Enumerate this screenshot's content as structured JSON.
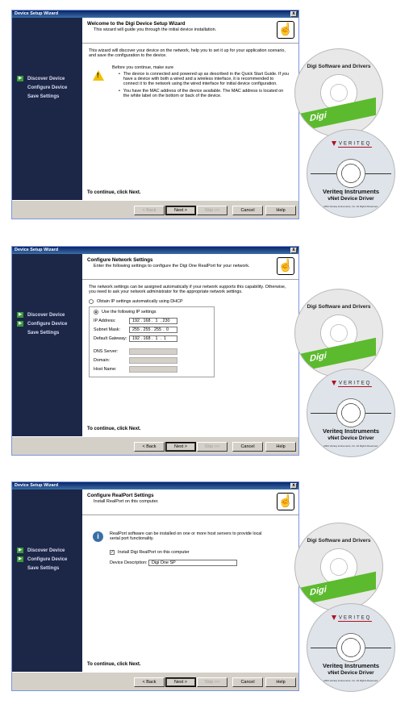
{
  "window_title": "Device Setup Wizard",
  "close_glyph": "x",
  "steps": [
    "Discover Device",
    "Configure Device",
    "Save Settings"
  ],
  "buttons": {
    "back": "< Back",
    "next": "Next >",
    "skip": "Skip >>",
    "cancel": "Cancel",
    "help": "Help"
  },
  "footer": "To continue, click Next.",
  "wizard_icon": "hand-pointer-icon",
  "screen1": {
    "title": "Welcome to the Digi Device Setup Wizard",
    "subtitle": "This wizard will guide you through the initial device installation.",
    "intro": "This wizard will discover your device on the network, help you to set it up for your application scenario, and save the configuration to the device.",
    "before": "Before you continue, make sure",
    "bullet1": "The device is connected and powered up as described in the Quick Start Guide. If you have a device with both a wired and a wireless interface, it is recommended to connect it to the network using the wired interface for initial device configuration.",
    "bullet2": "You have the MAC address of the device available. The MAC address is located on the white label on the bottom or back of the device."
  },
  "screen2": {
    "title": "Configure Network Settings",
    "subtitle": "Enter the following settings to configure the Digi One RealPort for your network.",
    "intro": "The network settings can be assigned automatically if your network supports this capability. Otherwise, you need to ask your network administrator for the appropriate network settings.",
    "opt_dhcp": "Obtain IP settings automatically using DHCP",
    "opt_static": "Use the following IP settings",
    "ip_label": "IP Address:",
    "ip_value": "192 . 168 .  1  . 230",
    "mask_label": "Subnet Mask:",
    "mask_value": "255 . 255 . 255 .  0",
    "gw_label": "Default Gateway:",
    "gw_value": "192 . 168 .  1  .  1",
    "dns_label": "DNS Server:",
    "domain_label": "Domain:",
    "host_label": "Host Name:"
  },
  "screen3": {
    "title": "Configure RealPort Settings",
    "subtitle": "Install RealPort on this computer.",
    "info": "RealPort software can be installed on one or more host servers to provide local serial port functionality.",
    "checkbox": "Install Digi RealPort on this computer",
    "checkbox_checked": true,
    "desc_label": "Device Description:",
    "desc_value": "Digi One SP"
  },
  "cd_digi": {
    "title": "Digi Software and Drivers",
    "logo": "Digi"
  },
  "cd_veriteq": {
    "logo": "VERITEQ",
    "line1": "Veriteq Instruments",
    "line2": "vNet Device Driver",
    "fine": "2004 Veriteq Instruments, Inc. All Rights Reserved."
  },
  "colors": {
    "sidebar": "#1c2647",
    "titlebar": "#0a246a",
    "digi_green": "#5cba2e",
    "veriteq_red": "#b01020"
  }
}
